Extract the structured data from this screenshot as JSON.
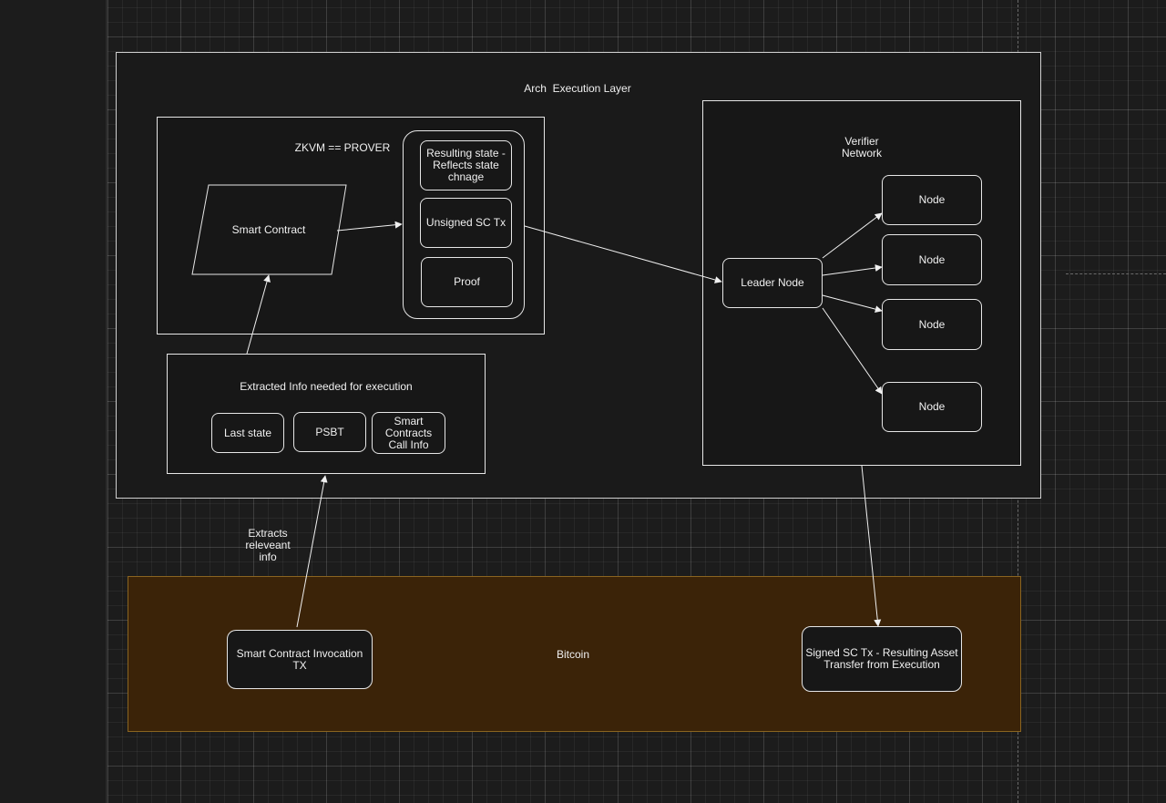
{
  "diagram": {
    "arch_layer_title": "Arch  Execution Layer",
    "zkvm_title": "ZKVM == PROVER",
    "smart_contract": "Smart Contract",
    "resulting_state": "Resulting state - Reflects state chnage",
    "unsigned_tx": "Unsigned SC Tx",
    "proof": "Proof",
    "extracted_title": "Extracted Info needed for execution",
    "last_state": "Last state",
    "psbt": "PSBT",
    "sc_call_info": "Smart Contracts Call Info",
    "verifier_title": "Verifier Network",
    "leader_node": "Leader Node",
    "nodes": [
      "Node",
      "Node",
      "Node",
      "Node"
    ],
    "extracts_label": "Extracts releveant info",
    "bitcoin_title": "Bitcoin",
    "invocation_tx": "Smart Contract Invocation TX",
    "signed_tx": "Signed SC Tx - Resulting Asset Transfer from Execution"
  },
  "colors": {
    "canvas": "#1c1c1c",
    "stroke": "#e6e6e6",
    "bitcoin_fill": "#3b2308",
    "bitcoin_stroke": "#8a6420"
  }
}
